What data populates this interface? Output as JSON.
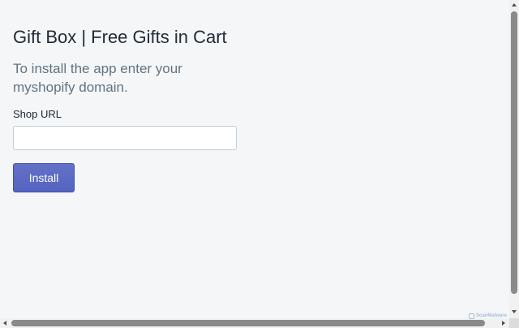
{
  "page": {
    "title": "Gift Box | Free Gifts in Cart",
    "subtitle": "To install the app enter your myshopify domain."
  },
  "form": {
    "shop_url_label": "Shop URL",
    "shop_url_value": "",
    "shop_url_placeholder": "",
    "install_label": "Install"
  },
  "watermark": {
    "text": "ScanMalware",
    "icon": "scan-shield-icon"
  },
  "colors": {
    "background": "#f4f6f8",
    "title": "#212b36",
    "subtitle": "#637381",
    "primary_button": "#5c6ac4",
    "input_border": "#c4cdd5"
  }
}
